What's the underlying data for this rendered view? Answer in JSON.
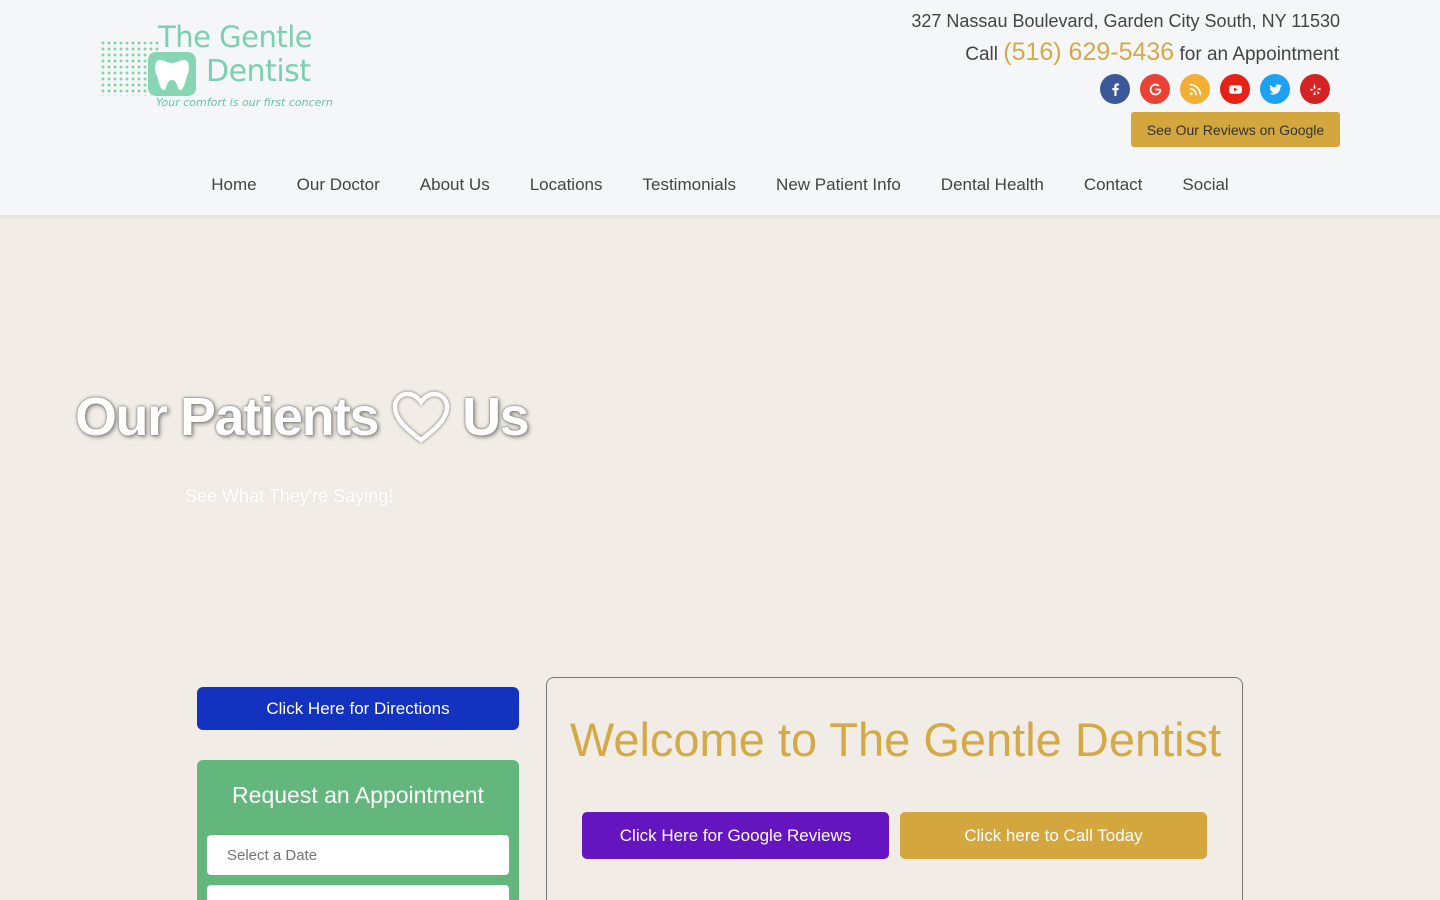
{
  "logo": {
    "line1": "The Gentle",
    "line2": "Dentist",
    "tagline": "Your comfort is our first concern"
  },
  "contact": {
    "address": "327 Nassau Boulevard,  Garden City South, NY 11530",
    "call_prefix": "Call",
    "phone": "(516) 629-5436",
    "call_suffix": "for an Appointment",
    "reviews_button": "See Our Reviews on Google"
  },
  "social": [
    {
      "name": "facebook-icon",
      "color": "#3b5998"
    },
    {
      "name": "google-icon",
      "color": "#ea4335"
    },
    {
      "name": "rss-icon",
      "color": "#f2b033"
    },
    {
      "name": "youtube-icon",
      "color": "#e62117"
    },
    {
      "name": "twitter-icon",
      "color": "#1da1f2"
    },
    {
      "name": "yelp-icon",
      "color": "#d32323"
    }
  ],
  "nav": {
    "items": [
      "Home",
      "Our Doctor",
      "About Us",
      "Locations",
      "Testimonials",
      "New Patient Info",
      "Dental Health",
      "Contact",
      "Social"
    ]
  },
  "hero": {
    "title_before": "Our Patients",
    "title_after": "Us",
    "subtitle": "See What They're Saying!"
  },
  "sidebar": {
    "directions_button": "Click Here for Directions",
    "appointment_title": "Request an Appointment",
    "date_placeholder": "Select a Date"
  },
  "welcome": {
    "title": "Welcome to The Gentle Dentist",
    "google_button": "Click Here for Google Reviews",
    "call_button": "Click here to Call Today"
  },
  "colors": {
    "gold": "#d4a947",
    "blue": "#1432c0",
    "purple": "#6515c0",
    "green": "#63b77c"
  }
}
